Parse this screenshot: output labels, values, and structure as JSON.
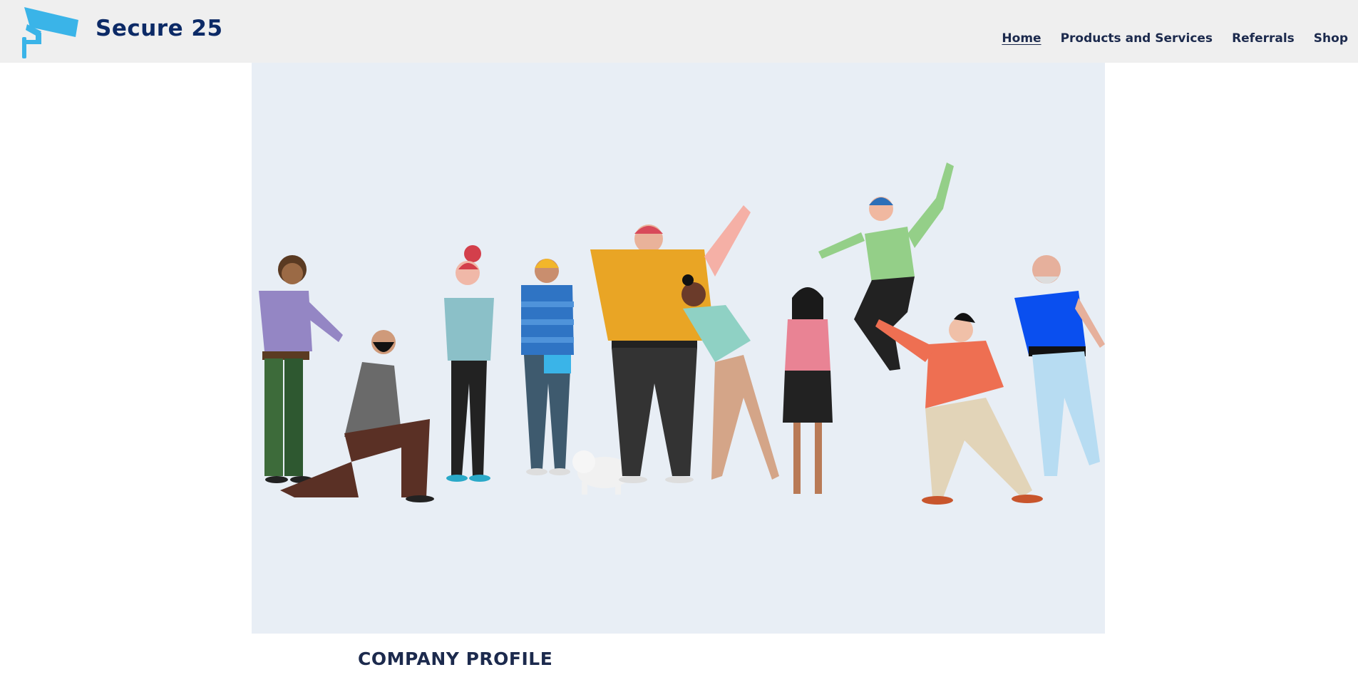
{
  "header": {
    "brand": "Secure 25",
    "logo_icon": "security-camera-icon",
    "logo_color": "#3ab4e8",
    "brand_color": "#0c2a66"
  },
  "nav": {
    "items": [
      {
        "label": "Home",
        "active": true
      },
      {
        "label": "Products and Services",
        "active": false
      },
      {
        "label": "Referrals",
        "active": false
      },
      {
        "label": "Shop",
        "active": false
      }
    ]
  },
  "hero": {
    "image": "group-of-diverse-people-illustration",
    "background": "#e8eef5"
  },
  "section": {
    "title": "COMPANY PROFILE"
  }
}
